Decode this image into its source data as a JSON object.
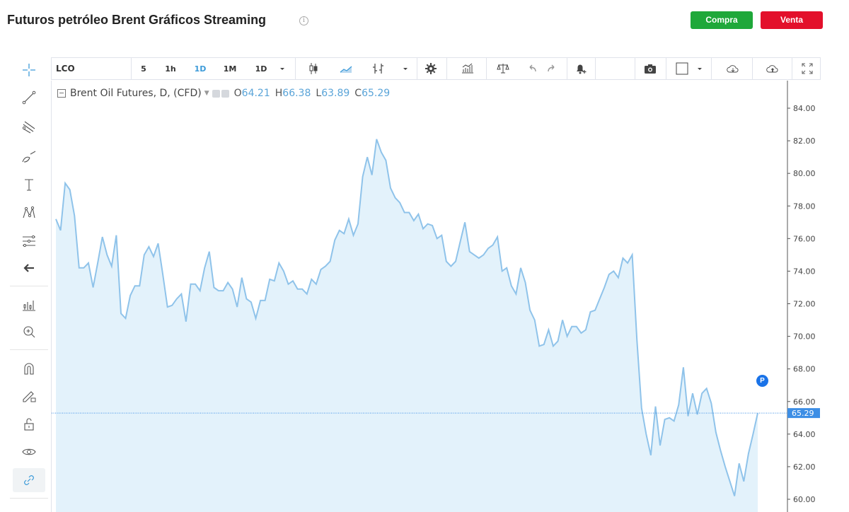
{
  "header": {
    "title": "Futuros petróleo Brent Gráficos Streaming",
    "buy_label": "Compra",
    "sell_label": "Venta",
    "buy_color": "#1fa83a",
    "sell_color": "#e3102b"
  },
  "toolbar": {
    "symbol": "LCO",
    "intervals": [
      "5",
      "1h",
      "1D",
      "1M",
      "1D"
    ],
    "active_interval": "1D"
  },
  "legend": {
    "name": "Brent Oil Futures, D, (CFD)",
    "o_key": "O",
    "o_val": "64.21",
    "h_key": "H",
    "h_val": "66.38",
    "l_key": "L",
    "l_val": "63.89",
    "c_key": "C",
    "c_val": "65.29"
  },
  "badge": "P",
  "left_tools": [
    "crosshair-icon",
    "trend-line-icon",
    "pitchfork-icon",
    "brush-icon",
    "text-icon",
    "pattern-icon",
    "fib-icon",
    "back-arrow-icon",
    "indicators-icon",
    "zoom-in-icon",
    "magnet-icon",
    "lock-drawing-icon",
    "unlock-icon",
    "eye-icon",
    "link-icon"
  ],
  "chart_data": {
    "type": "area",
    "series": [
      {
        "values": [
          77.2,
          76.5,
          79.4,
          79.0,
          77.4,
          74.2,
          74.2,
          74.5,
          73.0,
          74.5,
          76.1,
          75.0,
          74.3,
          76.2,
          71.4,
          71.1,
          72.5,
          73.1,
          73.1,
          75.0,
          75.5,
          74.9,
          75.7,
          73.8,
          71.8,
          71.9,
          72.3,
          72.6,
          70.9,
          73.2,
          73.2,
          72.8,
          74.2,
          75.2,
          73.0,
          72.8,
          72.8,
          73.3,
          72.9,
          71.8,
          73.6,
          72.3,
          72.1,
          71.1,
          72.2,
          72.2,
          73.5,
          73.4,
          74.5,
          74.0,
          73.2,
          73.4,
          72.9,
          72.9,
          72.6,
          73.5,
          73.2,
          74.1,
          74.3,
          74.6,
          75.9,
          76.5,
          76.3,
          77.2,
          76.2,
          76.9,
          79.8,
          81.0,
          79.9,
          82.1,
          81.3,
          80.8,
          79.1,
          78.5,
          78.2,
          77.6,
          77.6,
          77.1,
          77.5,
          76.6,
          76.9,
          76.8,
          76.0,
          76.2,
          74.6,
          74.3,
          74.6,
          75.8,
          77.0,
          75.2,
          75.0,
          74.8,
          75.0,
          75.4,
          75.6,
          76.1,
          74.0,
          74.2,
          73.1,
          72.6,
          74.2,
          73.3,
          71.6,
          71.0,
          69.4,
          69.5,
          70.4,
          69.4,
          69.7,
          71.0,
          70.0,
          70.6,
          70.6,
          70.2,
          70.4,
          71.5,
          71.6,
          72.3,
          73.0,
          73.8,
          74.0,
          73.6,
          74.8,
          74.5,
          75.0,
          69.8,
          65.6,
          64.0,
          62.7,
          65.7,
          63.3,
          64.9,
          65.0,
          64.8,
          65.8,
          68.1,
          65.1,
          66.5,
          65.2,
          66.5,
          66.8,
          65.9,
          64.1,
          63.0,
          62.0,
          61.1,
          60.2,
          62.2,
          61.1,
          62.8,
          64.0,
          65.29
        ],
        "last": 65.29
      }
    ],
    "y_ticks": [
      "84.00",
      "82.00",
      "80.00",
      "78.00",
      "76.00",
      "74.00",
      "72.00",
      "70.00",
      "68.00",
      "66.00",
      "64.00",
      "62.00",
      "60.00"
    ],
    "ylim": [
      59.2,
      85.5
    ],
    "line_color": "#8fc3ea",
    "fill_color": "#e3f2fb",
    "last_price_label": "65.29",
    "last_price_color": "#3d8ee5",
    "grid": false
  }
}
